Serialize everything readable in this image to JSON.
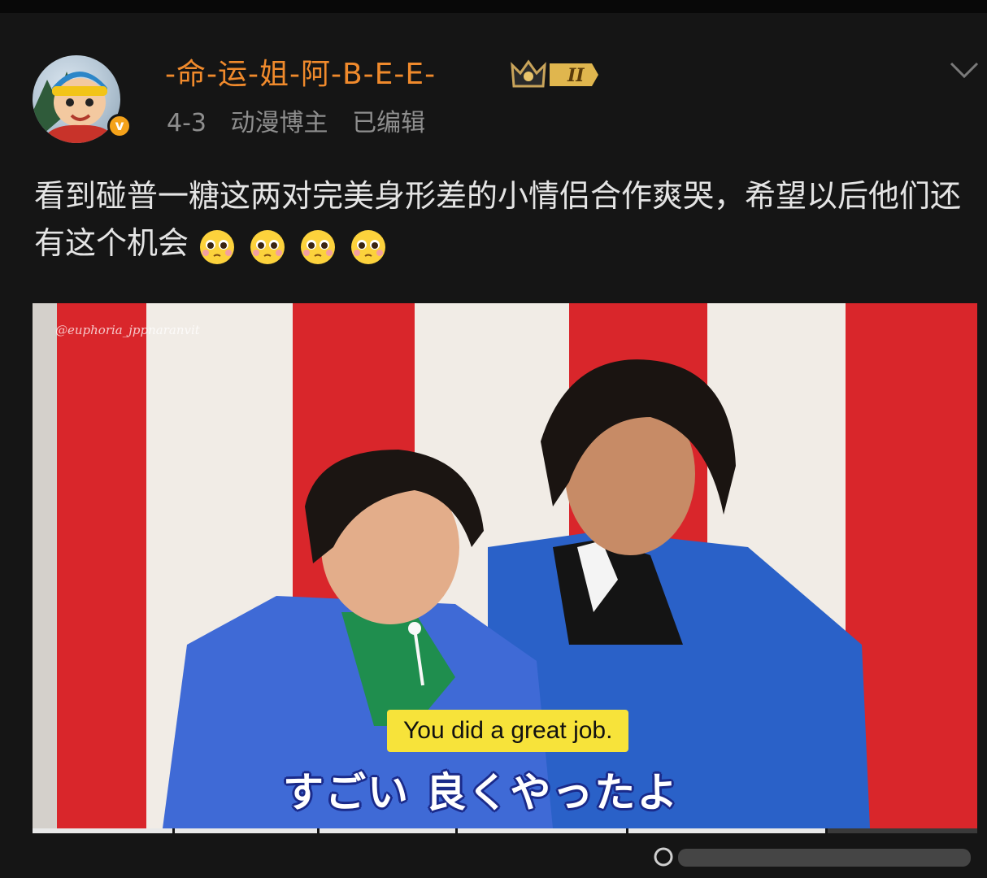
{
  "post": {
    "username": "-命-运-姐-阿-B-E-E-",
    "badge_level": "II",
    "date": "4-3",
    "user_tag": "动漫博主",
    "edited": "已编辑",
    "verified_mark": "v",
    "text": "看到碰普一糖这两对完美身形差的小情侣合作爽哭，希望以后他们还有这个机会",
    "emoji_count": 4
  },
  "media": {
    "watermark": "@euphoria_jppnaranvit",
    "subtitle_en": "You did a great job.",
    "subtitle_jp": "すごい 良くやったよ",
    "progress_fraction": 0.84
  },
  "icons": {
    "menu": "chevron-down-icon",
    "badge": "crown-badge-icon",
    "emoji": "pleading-face-emoji-icon"
  },
  "colors": {
    "username": "#f08a2c",
    "background": "#151515",
    "verified": "#f4a21a",
    "subtitle_bg": "#f7e33a"
  }
}
